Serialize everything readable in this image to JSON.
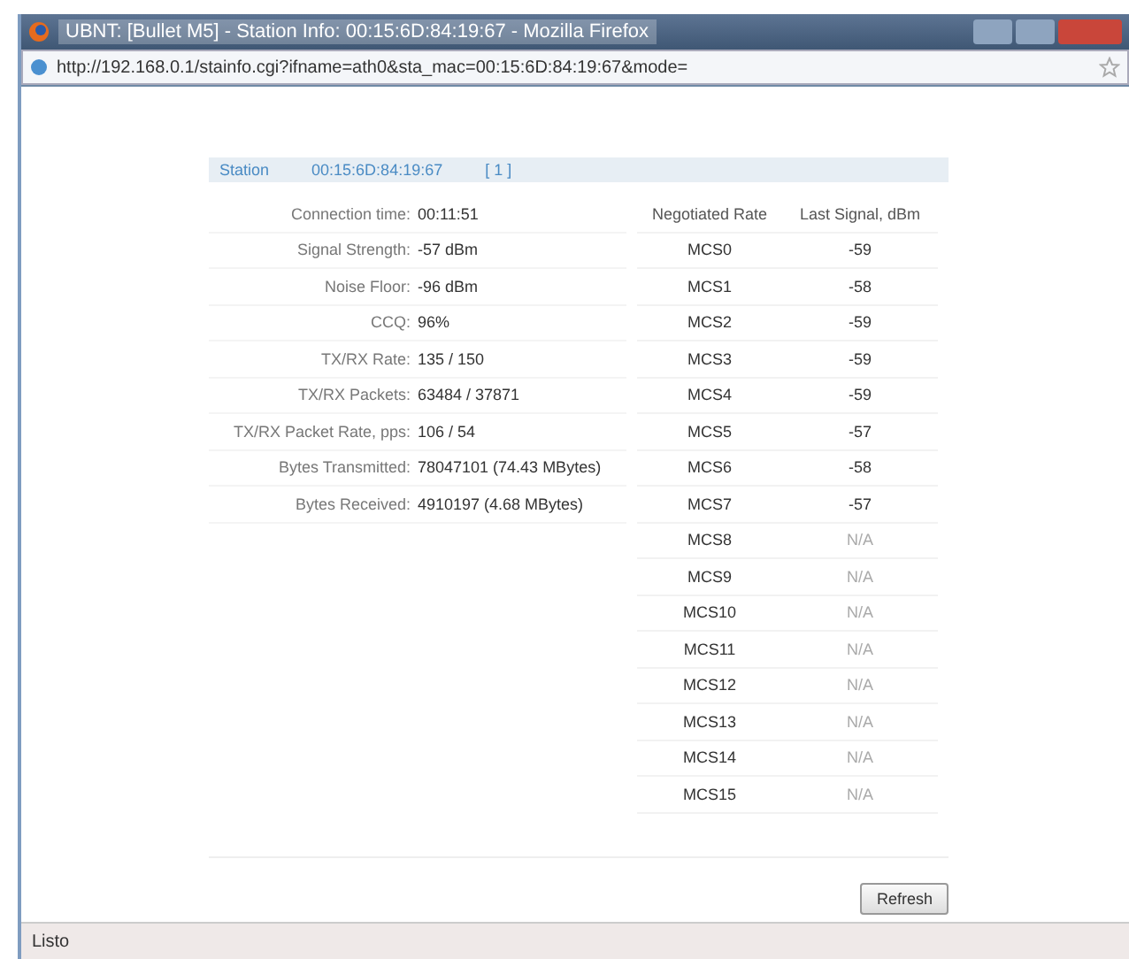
{
  "window": {
    "title": "UBNT: [Bullet M5] - Station Info: 00:15:6D:84:19:67 - Mozilla Firefox"
  },
  "address_bar": {
    "url": "http://192.168.0.1/stainfo.cgi?ifname=ath0&sta_mac=00:15:6D:84:19:67&mode="
  },
  "station_header": {
    "label": "Station",
    "mac": "00:15:6D:84:19:67",
    "count": "[ 1 ]"
  },
  "info": [
    {
      "label": "Connection time:",
      "value": "00:11:51"
    },
    {
      "label": "Signal Strength:",
      "value": "-57 dBm"
    },
    {
      "label": "Noise Floor:",
      "value": "-96 dBm"
    },
    {
      "label": "CCQ:",
      "value": "96%"
    },
    {
      "label": "TX/RX Rate:",
      "value": "135 / 150"
    },
    {
      "label": "TX/RX Packets:",
      "value": "63484 / 37871"
    },
    {
      "label": "TX/RX Packet Rate, pps:",
      "value": "106 / 54"
    },
    {
      "label": "Bytes Transmitted:",
      "value": "78047101 (74.43 MBytes)"
    },
    {
      "label": "Bytes Received:",
      "value": "4910197 (4.68 MBytes)"
    }
  ],
  "rates": {
    "columns": [
      "Negotiated Rate",
      "Last Signal, dBm"
    ],
    "rows": [
      {
        "rate": "MCS0",
        "signal": "-59",
        "disabled": false
      },
      {
        "rate": "MCS1",
        "signal": "-58",
        "disabled": false
      },
      {
        "rate": "MCS2",
        "signal": "-59",
        "disabled": false
      },
      {
        "rate": "MCS3",
        "signal": "-59",
        "disabled": false
      },
      {
        "rate": "MCS4",
        "signal": "-59",
        "disabled": false
      },
      {
        "rate": "MCS5",
        "signal": "-57",
        "disabled": false
      },
      {
        "rate": "MCS6",
        "signal": "-58",
        "disabled": false
      },
      {
        "rate": "MCS7",
        "signal": "-57",
        "disabled": false
      },
      {
        "rate": "MCS8",
        "signal": "N/A",
        "disabled": true
      },
      {
        "rate": "MCS9",
        "signal": "N/A",
        "disabled": true
      },
      {
        "rate": "MCS10",
        "signal": "N/A",
        "disabled": true
      },
      {
        "rate": "MCS11",
        "signal": "N/A",
        "disabled": true
      },
      {
        "rate": "MCS12",
        "signal": "N/A",
        "disabled": true
      },
      {
        "rate": "MCS13",
        "signal": "N/A",
        "disabled": true
      },
      {
        "rate": "MCS14",
        "signal": "N/A",
        "disabled": true
      },
      {
        "rate": "MCS15",
        "signal": "N/A",
        "disabled": true
      }
    ]
  },
  "buttons": [
    "Refresh"
  ],
  "status_bar": {
    "text": "Listo"
  }
}
